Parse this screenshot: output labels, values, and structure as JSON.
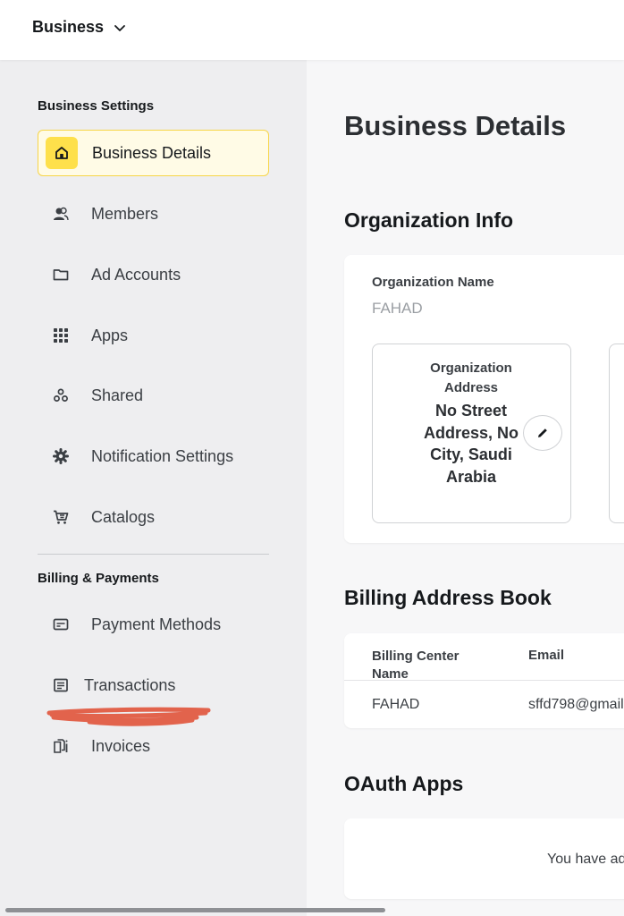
{
  "header": {
    "business_switcher": "Business"
  },
  "sidebar": {
    "business_settings_title": "Business Settings",
    "items": [
      {
        "label": "Business Details",
        "icon": "home-icon",
        "active": true
      },
      {
        "label": "Members",
        "icon": "members-icon"
      },
      {
        "label": "Ad Accounts",
        "icon": "folder-icon"
      },
      {
        "label": "Apps",
        "icon": "grid-icon"
      },
      {
        "label": "Shared",
        "icon": "shared-icon"
      },
      {
        "label": "Notification Settings",
        "icon": "gear-icon"
      },
      {
        "label": "Catalogs",
        "icon": "cart-icon"
      }
    ],
    "billing_title": "Billing & Payments",
    "billing_items": [
      {
        "label": "Payment Methods",
        "icon": "credit-card-icon"
      },
      {
        "label": "Transactions",
        "icon": "receipt-icon"
      },
      {
        "label": "Invoices",
        "icon": "invoice-icon"
      }
    ]
  },
  "main": {
    "page_title": "Business Details",
    "org_info": {
      "title": "Organization Info",
      "name_label": "Organization Name",
      "name_value": "FAHAD",
      "address_label": "Organization Address",
      "address_value": "No Street Address, No City, Saudi Arabia"
    },
    "billing_book": {
      "title": "Billing Address Book",
      "columns": [
        "Billing Center Name",
        "Email"
      ],
      "rows": [
        [
          "FAHAD",
          "sffd798@gmail"
        ]
      ]
    },
    "oauth": {
      "title": "OAuth Apps",
      "empty_text": "You have ad"
    }
  },
  "colors": {
    "accent_yellow": "#fee04b",
    "active_bg": "#fffbe6",
    "sidebar_bg": "#eeeef0",
    "scribble": "#e0533a"
  }
}
